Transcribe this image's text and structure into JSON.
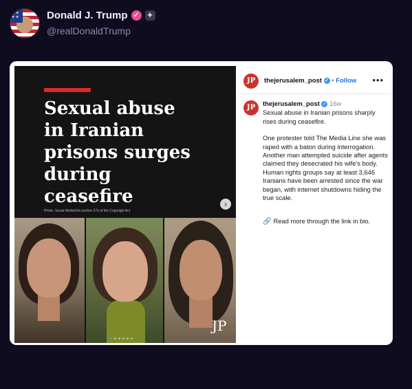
{
  "author": {
    "display_name": "Donald J. Trump",
    "handle": "@realDonaldTrump",
    "verified_glyph": "✓",
    "plus_glyph": "+"
  },
  "media": {
    "headline": "Sexual abuse\nin Iranian\nprisons surges\nduring\nceasefire",
    "photo_credit": "Photo: Social Media/Via section 27a of the Copyright Act",
    "watermark": "JP",
    "next_glyph": "›",
    "slide_count": 6,
    "active_slide": 1
  },
  "embed": {
    "logo_text": "JP",
    "account": "thejerusalem_post",
    "follow_label": "Follow",
    "separator": "•",
    "more_glyph": "•••",
    "post_age": "16w",
    "caption_paragraphs": [
      "Sexual abuse in Iranian prisons sharply rises during ceasefire.",
      "One protester told The Media Line she was raped with a baton during interrogation. Another man attempted suicide after agents claimed they desecrated his wife's body. Human rights groups say at least 3,646 Iranians have been arrested since the war began, with internet shutdowns hiding the true scale."
    ],
    "link_glyph": "🔗",
    "read_more": "Read more through the link in bio."
  },
  "colors": {
    "page_bg": "#0f0c1f",
    "verified_badge": "#e94e8f",
    "headline_accent": "#d62b2b",
    "link_blue": "#1b73e8",
    "jp_red": "#c9332d"
  }
}
